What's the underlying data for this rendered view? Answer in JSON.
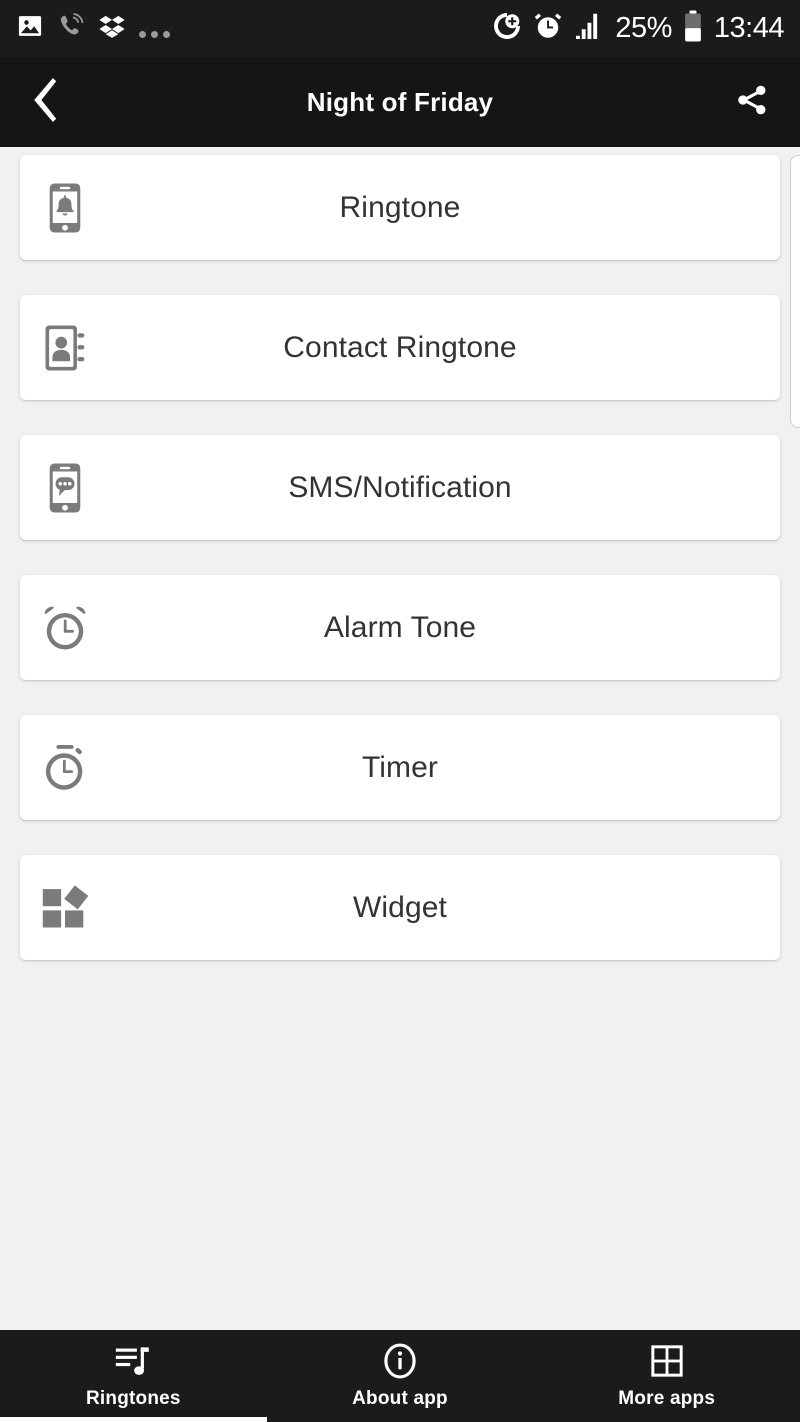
{
  "status_bar": {
    "time": "13:44",
    "battery_percent": "25%",
    "left_icons": [
      "photo-icon",
      "phone-ringing-icon",
      "dropbox-icon",
      "more-dots-icon"
    ],
    "right_icons": [
      "sync-add-icon",
      "alarm-icon",
      "signal-bars-icon",
      "battery-icon"
    ],
    "background": "#1b1b1b",
    "foreground": "#ffffff"
  },
  "title_bar": {
    "back_icon": "back-chevron-icon",
    "title": "Night of Friday",
    "share_icon": "share-icon",
    "background": "#151515"
  },
  "main": {
    "background": "#f1f1f1",
    "cards": [
      {
        "icon": "phone-bell-icon",
        "label": "Ringtone"
      },
      {
        "icon": "contact-book-icon",
        "label": "Contact Ringtone"
      },
      {
        "icon": "phone-message-icon",
        "label": "SMS/Notification"
      },
      {
        "icon": "alarm-clock-icon",
        "label": "Alarm Tone"
      },
      {
        "icon": "stopwatch-icon",
        "label": "Timer"
      },
      {
        "icon": "widget-squares-icon",
        "label": "Widget"
      }
    ],
    "peek_card": "next-page-card"
  },
  "bottom_nav": {
    "background": "#1b1b1b",
    "active_index": 0,
    "items": [
      {
        "icon": "playlist-music-icon",
        "label": "Ringtones"
      },
      {
        "icon": "info-circle-icon",
        "label": "About app"
      },
      {
        "icon": "grid-apps-icon",
        "label": "More apps"
      }
    ]
  }
}
